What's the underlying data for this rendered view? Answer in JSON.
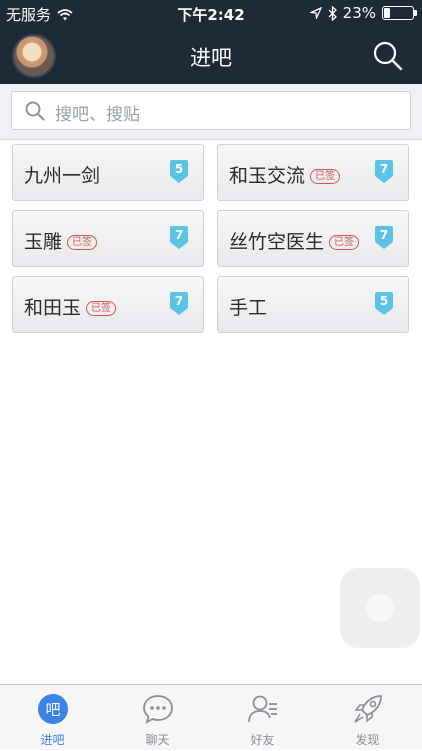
{
  "status_bar": {
    "carrier": "无服务",
    "time": "下午2:42",
    "battery": "23%",
    "battery_level": 0.23
  },
  "nav": {
    "title": "进吧"
  },
  "search": {
    "placeholder": "搜吧、搜贴"
  },
  "forums": [
    {
      "name": "九州一剑",
      "signed": false,
      "level": "5"
    },
    {
      "name": "和玉交流",
      "signed": true,
      "signed_label": "已签",
      "level": "7"
    },
    {
      "name": "玉雕",
      "signed": true,
      "signed_label": "已签",
      "level": "7"
    },
    {
      "name": "丝竹空医生",
      "signed": true,
      "signed_label": "已签",
      "level": "7"
    },
    {
      "name": "和田玉",
      "signed": true,
      "signed_label": "已签",
      "level": "7"
    },
    {
      "name": "手工",
      "signed": false,
      "level": "5"
    }
  ],
  "tabs": [
    {
      "label": "进吧",
      "icon": "forum-icon",
      "active": true,
      "badge": "吧"
    },
    {
      "label": "聊天",
      "icon": "chat-bubble-icon",
      "active": false
    },
    {
      "label": "好友",
      "icon": "friends-icon",
      "active": false
    },
    {
      "label": "发现",
      "icon": "rocket-icon",
      "active": false
    }
  ],
  "colors": {
    "header": "#1f2a38",
    "accent": "#3a84e8",
    "level_badge": "#5bc3e4",
    "signed_stamp": "#d05a4a"
  }
}
